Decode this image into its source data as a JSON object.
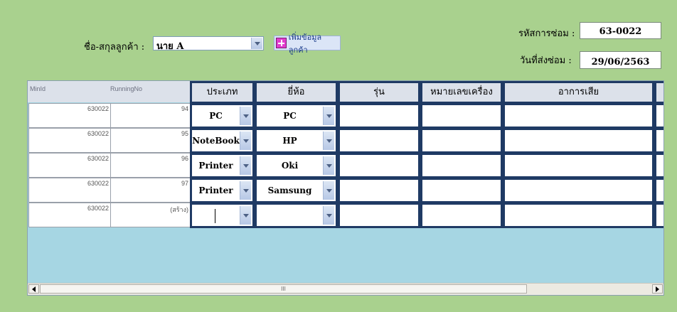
{
  "form": {
    "customer_label": "ชื่อ-สกุลลูกค้า :",
    "customer_value": "นาย A",
    "add_customer_label": "เพิ่มข้อมูลลูกค้า",
    "repair_code_label": "รหัสการซ่อม :",
    "repair_code_value": "63-0022",
    "repair_date_label": "วันที่ส่งซ่อม :",
    "repair_date_value": "29/06/2563"
  },
  "grid": {
    "headers": {
      "minid": "MinId",
      "running": "RunningNo",
      "type": "ประเภท",
      "brand": "ยี่ห้อ",
      "model": "รุ่น",
      "serial": "หมายเลขเครื่อง",
      "symptom": "อาการเสีย"
    },
    "rows": [
      {
        "minid": "630022",
        "running": "94",
        "type": "PC",
        "brand": "PC",
        "model": "",
        "serial": "",
        "symptom": ""
      },
      {
        "minid": "630022",
        "running": "95",
        "type": "NoteBook",
        "brand": "HP",
        "model": "",
        "serial": "",
        "symptom": ""
      },
      {
        "minid": "630022",
        "running": "96",
        "type": "Printer",
        "brand": "Oki",
        "model": "",
        "serial": "",
        "symptom": ""
      },
      {
        "minid": "630022",
        "running": "97",
        "type": "Printer",
        "brand": "Samsung",
        "model": "",
        "serial": "",
        "symptom": ""
      },
      {
        "minid": "630022",
        "running": "(สร้าง)",
        "type": "",
        "brand": "",
        "model": "",
        "serial": "",
        "symptom": ""
      }
    ],
    "scroll_thumb_label": "III"
  }
}
